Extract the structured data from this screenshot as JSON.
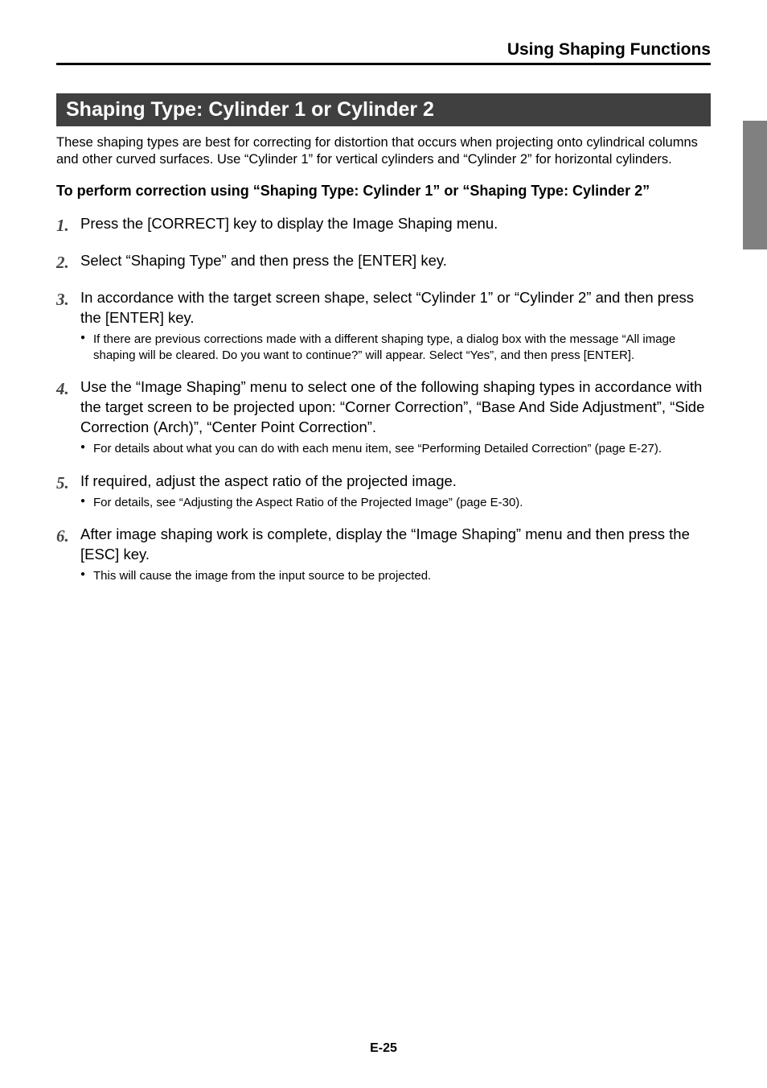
{
  "header": {
    "running_title": "Using Shaping Functions"
  },
  "section": {
    "heading": "Shaping Type: Cylinder 1 or Cylinder 2",
    "intro": "These shaping types are best for correcting for distortion that occurs when projecting onto cylindrical columns and other curved surfaces. Use “Cylinder 1” for vertical cylinders and “Cylinder 2” for horizontal cylinders.",
    "subheading": "To perform correction using “Shaping Type: Cylinder 1” or “Shaping Type: Cylinder 2”"
  },
  "steps": [
    {
      "num": "1.",
      "text": "Press the [CORRECT] key to display the Image Shaping menu.",
      "notes": []
    },
    {
      "num": "2.",
      "text": "Select “Shaping Type” and then press the [ENTER] key.",
      "notes": []
    },
    {
      "num": "3.",
      "text": "In accordance with the target screen shape, select “Cylinder 1” or “Cylinder 2” and then press the [ENTER] key.",
      "notes": [
        "If there are previous corrections made with a different shaping type, a dialog box with the message “All image shaping will be cleared. Do you want to continue?” will appear. Select “Yes”, and then press [ENTER]."
      ]
    },
    {
      "num": "4.",
      "text": "Use the “Image Shaping” menu to select one of the following shaping types in accordance with the target screen to be projected upon: “Corner Correction”, “Base And Side Adjustment”, “Side Correction (Arch)”, “Center Point Correction”.",
      "notes": [
        "For details about what you can do with each menu item, see “Performing Detailed Correction” (page E-27)."
      ]
    },
    {
      "num": "5.",
      "text": "If required, adjust the aspect ratio of the projected image.",
      "notes": [
        "For details, see “Adjusting the Aspect Ratio of the Projected Image” (page E-30)."
      ]
    },
    {
      "num": "6.",
      "text": "After image shaping work is complete, display the “Image Shaping” menu and then press the [ESC] key.",
      "notes": [
        "This will cause the image from the input source to be projected."
      ]
    }
  ],
  "footer": {
    "page_number": "E-25"
  }
}
